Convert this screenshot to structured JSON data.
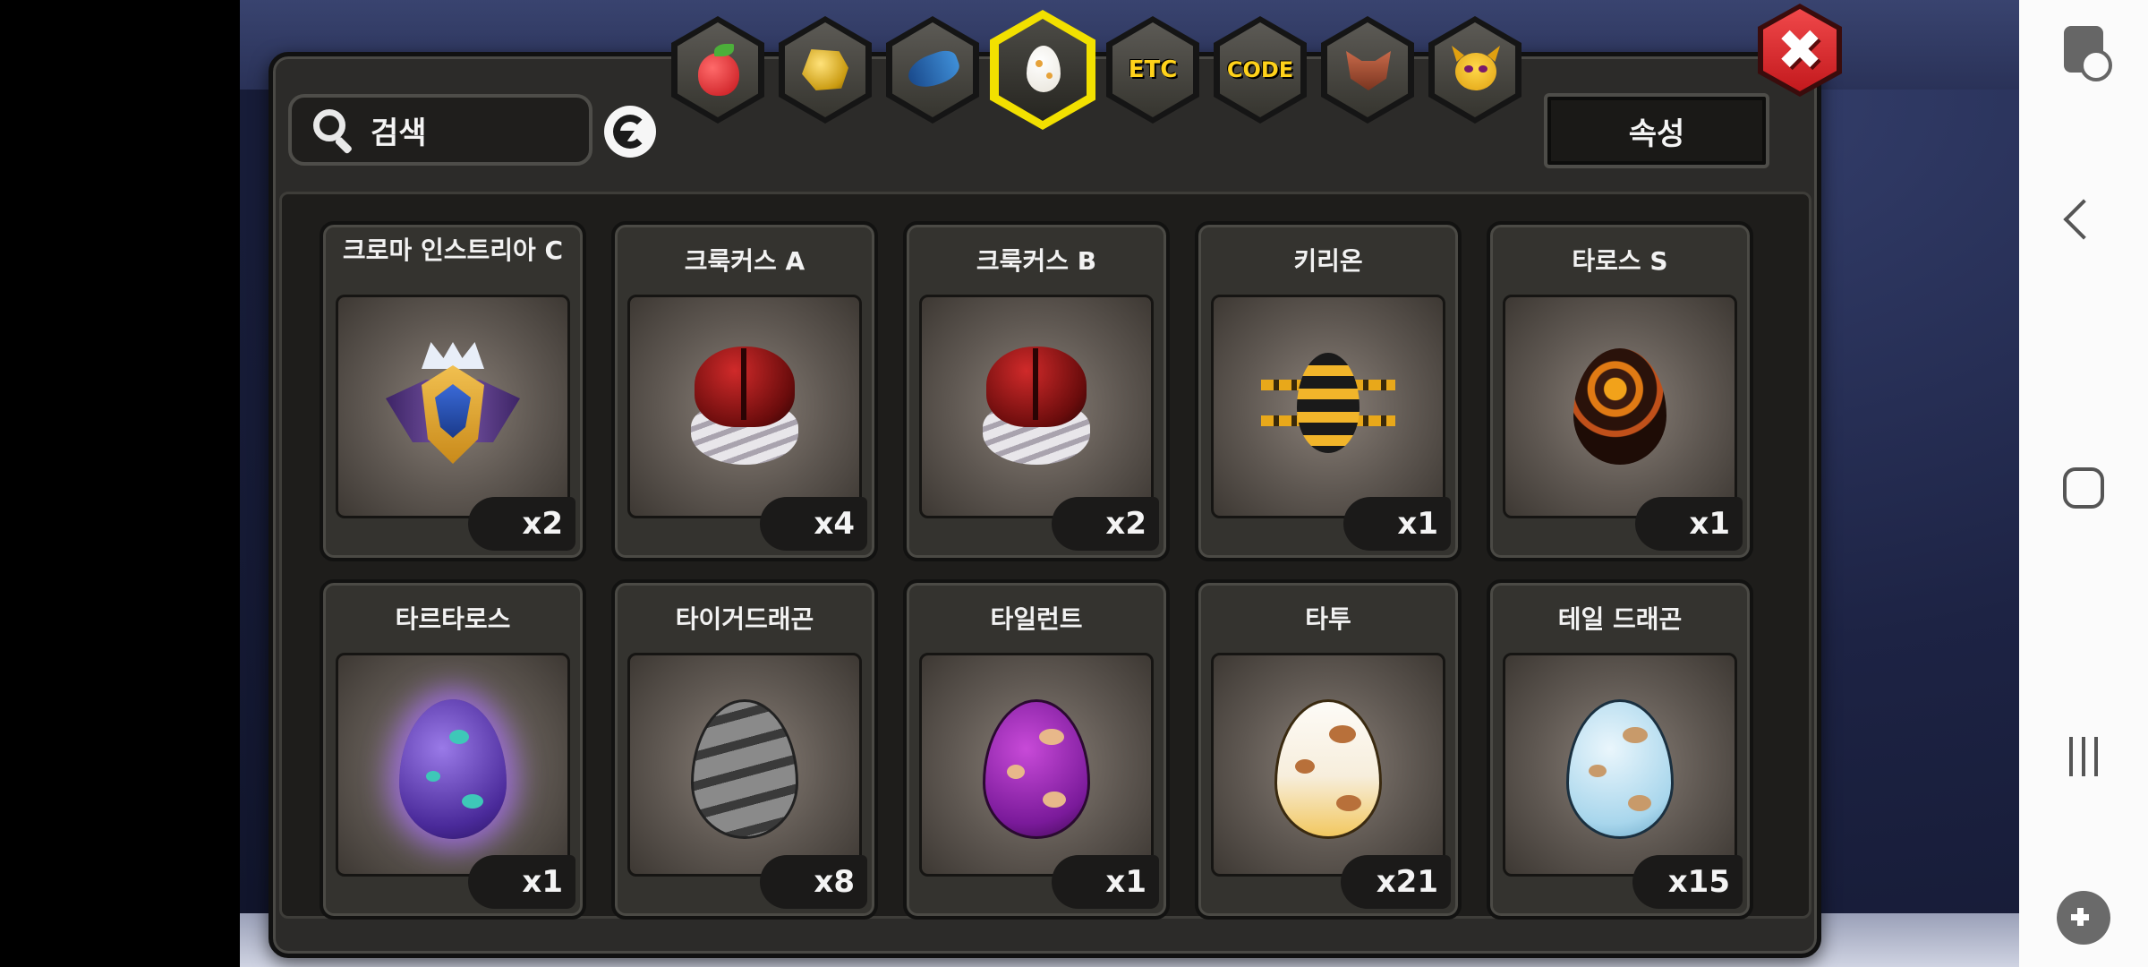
{
  "search": {
    "label": "검색"
  },
  "toolbar": {
    "attribute_label": "속성"
  },
  "tabs": [
    {
      "id": "fruit",
      "icon": "fruit-icon",
      "label": ""
    },
    {
      "id": "gold",
      "icon": "gold-nugget-icon",
      "label": ""
    },
    {
      "id": "dragon",
      "icon": "blue-dragon-icon",
      "label": ""
    },
    {
      "id": "egg",
      "icon": "egg-icon",
      "label": "",
      "active": true
    },
    {
      "id": "etc",
      "icon": "",
      "label": "ETC"
    },
    {
      "id": "code",
      "icon": "",
      "label": "CODE"
    },
    {
      "id": "beast",
      "icon": "wolf-head-icon",
      "label": ""
    },
    {
      "id": "mask",
      "icon": "horned-face-icon",
      "label": ""
    }
  ],
  "items": [
    {
      "name": "크로마 인스트리아 C",
      "count": "x2",
      "icon": "ornate-crest-egg-icon"
    },
    {
      "name": "크룩커스 A",
      "count": "x4",
      "icon": "red-shell-egg-icon"
    },
    {
      "name": "크룩커스 B",
      "count": "x2",
      "icon": "red-shell-egg-icon"
    },
    {
      "name": "키리온",
      "count": "x1",
      "icon": "striped-bee-egg-icon"
    },
    {
      "name": "타로스 S",
      "count": "x1",
      "icon": "lava-egg-icon"
    },
    {
      "name": "타르타로스",
      "count": "x1",
      "icon": "purple-glow-egg-icon"
    },
    {
      "name": "타이거드래곤",
      "count": "x8",
      "icon": "gray-striped-egg-icon"
    },
    {
      "name": "타일런트",
      "count": "x1",
      "icon": "magenta-egg-icon"
    },
    {
      "name": "타투",
      "count": "x21",
      "icon": "cream-egg-icon"
    },
    {
      "name": "테일 드래곤",
      "count": "x15",
      "icon": "light-blue-egg-icon"
    }
  ],
  "colors": {
    "active_tab_border": "#f2e000",
    "close_button": "#d8282c",
    "tab_text": "#ffd21a"
  }
}
